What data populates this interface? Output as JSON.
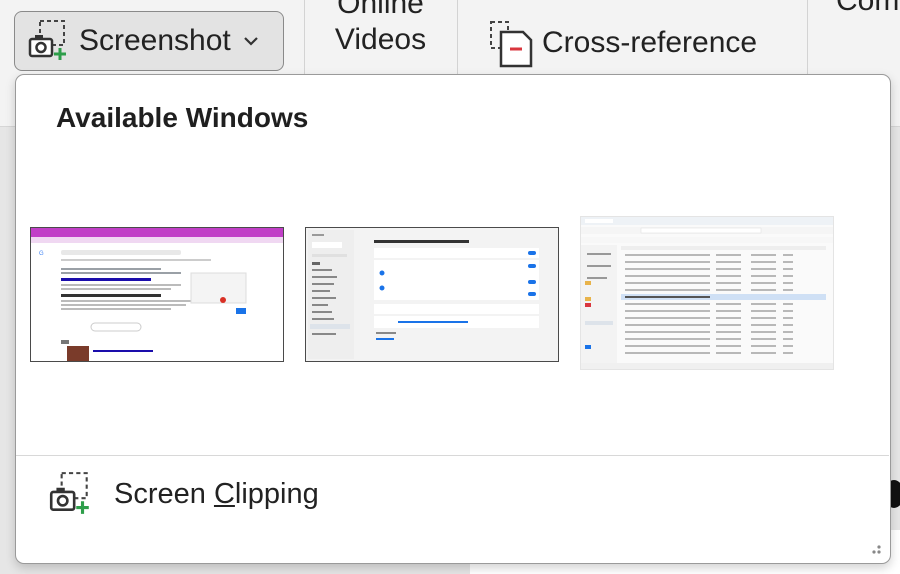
{
  "ribbon": {
    "screenshot_label": "Screenshot",
    "online_videos_line1": "Online",
    "online_videos_line2": "Videos",
    "cross_reference_label": "Cross-reference",
    "truncated_label": "Com"
  },
  "dropdown": {
    "title": "Available Windows",
    "windows": [
      {
        "name": "browser-window"
      },
      {
        "name": "settings-window"
      },
      {
        "name": "file-explorer-window"
      }
    ],
    "clipping_label_pre": "Screen ",
    "clipping_label_accel": "C",
    "clipping_label_post": "lipping"
  },
  "colors": {
    "accent_green": "#2e9e4a",
    "browser_header": "#c13fc7"
  },
  "icons": {
    "screenshot": "camera-with-plus-icon",
    "cross_reference": "cross-reference-icon",
    "screen_clipping": "camera-with-plus-icon",
    "caret": "chevron-down-icon",
    "resize": "resize-grip-icon"
  }
}
